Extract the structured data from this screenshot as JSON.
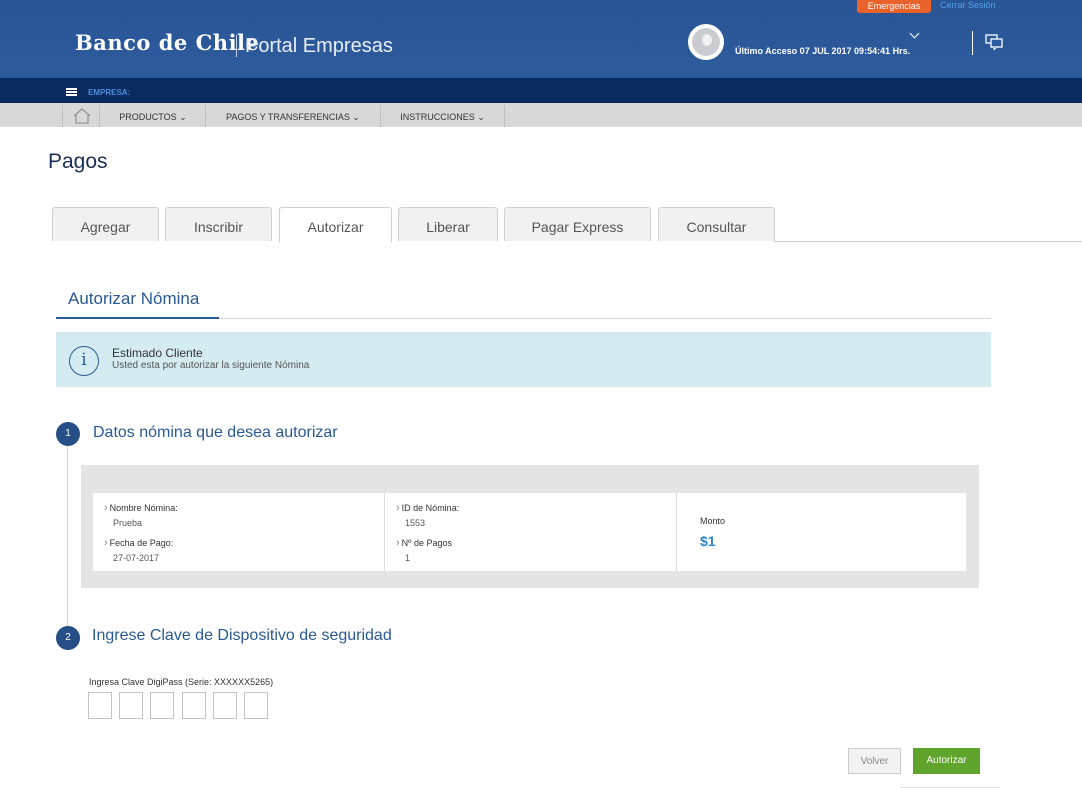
{
  "header": {
    "logo": "Banco de Chile",
    "portal": "Portal Empresas",
    "emergency_label": "Emergencias",
    "logout_label": "Cerrar Sesión",
    "last_access": "Último Acceso 07 JUL 2017 09:54:41 Hrs."
  },
  "company_bar": {
    "label": "EMPRESA:"
  },
  "nav": {
    "items": [
      "PRODUCTOS",
      "PAGOS Y TRANSFERENCIAS",
      "INSTRUCCIONES"
    ]
  },
  "page": {
    "title": "Pagos"
  },
  "tabs": [
    "Agregar",
    "Inscribir",
    "Autorizar",
    "Liberar",
    "Pagar Express",
    "Consultar"
  ],
  "active_tab": "Autorizar",
  "section": {
    "title": "Autorizar Nómina"
  },
  "info": {
    "title": "Estimado Cliente",
    "message": "Usted esta por autorizar la siguiente Nómina"
  },
  "step1": {
    "number": "1",
    "title": "Datos nómina que desea autorizar",
    "fields": {
      "nombre_label": "Nombre Nómina:",
      "nombre_value": "Prueba",
      "fecha_label": "Fecha de Pago:",
      "fecha_value": "27-07-2017",
      "id_label": "ID de Nómina:",
      "id_value": "1553",
      "pagos_label": "Nº de Pagos",
      "pagos_value": "1",
      "monto_label": "Monto",
      "monto_value": "$1"
    }
  },
  "step2": {
    "number": "2",
    "title": "Ingrese Clave de Dispositivo de seguridad",
    "digipass_label": "Ingresa Clave DigiPass (Serie: XXXXXX5265)"
  },
  "buttons": {
    "back": "Volver",
    "authorize": "Autorizar"
  },
  "colors": {
    "header_blue": "#2c5b9b",
    "accent_green": "#5fa52b",
    "emergency_orange": "#e8622a"
  }
}
